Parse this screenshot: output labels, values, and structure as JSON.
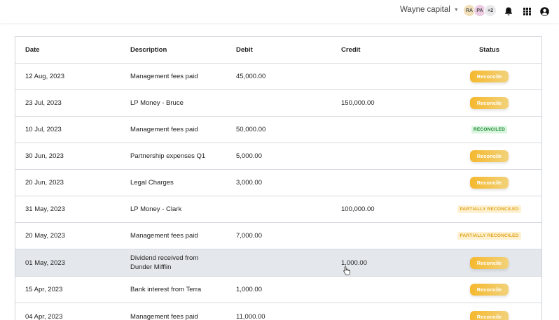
{
  "topbar": {
    "org_name": "Wayne capital",
    "avatars": [
      "RA",
      "PA",
      "+2"
    ],
    "icons": [
      "bell-icon",
      "apps-grid-icon",
      "account-icon"
    ]
  },
  "table": {
    "columns": [
      "Date",
      "Description",
      "Debit",
      "Credit",
      "Status"
    ],
    "rows": [
      {
        "date": "12 Aug, 2023",
        "description": "Management fees paid",
        "debit": "45,000.00",
        "credit": "",
        "status": "Reconcile"
      },
      {
        "date": "23 Jul, 2023",
        "description": "LP Money - Bruce",
        "debit": "",
        "credit": "150,000.00",
        "status": "Reconcile"
      },
      {
        "date": "10 Jul, 2023",
        "description": "Management fees paid",
        "debit": "50,000.00",
        "credit": "",
        "status": "RECONCILED"
      },
      {
        "date": "30 Jun, 2023",
        "description": "Partnership expenses Q1",
        "debit": "5,000.00",
        "credit": "",
        "status": "Reconcile"
      },
      {
        "date": "20 Jun, 2023",
        "description": "Legal Charges",
        "debit": "3,000.00",
        "credit": "",
        "status": "Reconcile"
      },
      {
        "date": "31 May, 2023",
        "description": "LP Money - Clark",
        "debit": "",
        "credit": "100,000.00",
        "status": "PARTIALLY RECONCILED"
      },
      {
        "date": "20 May, 2023",
        "description": "Management fees paid",
        "debit": "7,000.00",
        "credit": "",
        "status": "PARTIALLY RECONCILED"
      },
      {
        "date": "01 May, 2023",
        "description": "Dividend received from Dunder Mifflin",
        "debit": "",
        "credit": "1,000.00",
        "status": "Reconcile"
      },
      {
        "date": "15 Apr, 2023",
        "description": "Bank interest from Terra",
        "debit": "1,000.00",
        "credit": "",
        "status": "Reconcile"
      },
      {
        "date": "04 Apr, 2023",
        "description": "Management fees paid",
        "debit": "11,000.00",
        "credit": "",
        "status": "Reconcile"
      }
    ]
  },
  "colors": {
    "reconcile_button": "#f5b82e",
    "reconciled_badge_bg": "#d9f5dd",
    "reconciled_badge_text": "#1e8a35",
    "partial_badge_bg": "#fdf1d1",
    "partial_badge_text": "#e2a31c",
    "highlight_row": "#e4e8ec"
  }
}
